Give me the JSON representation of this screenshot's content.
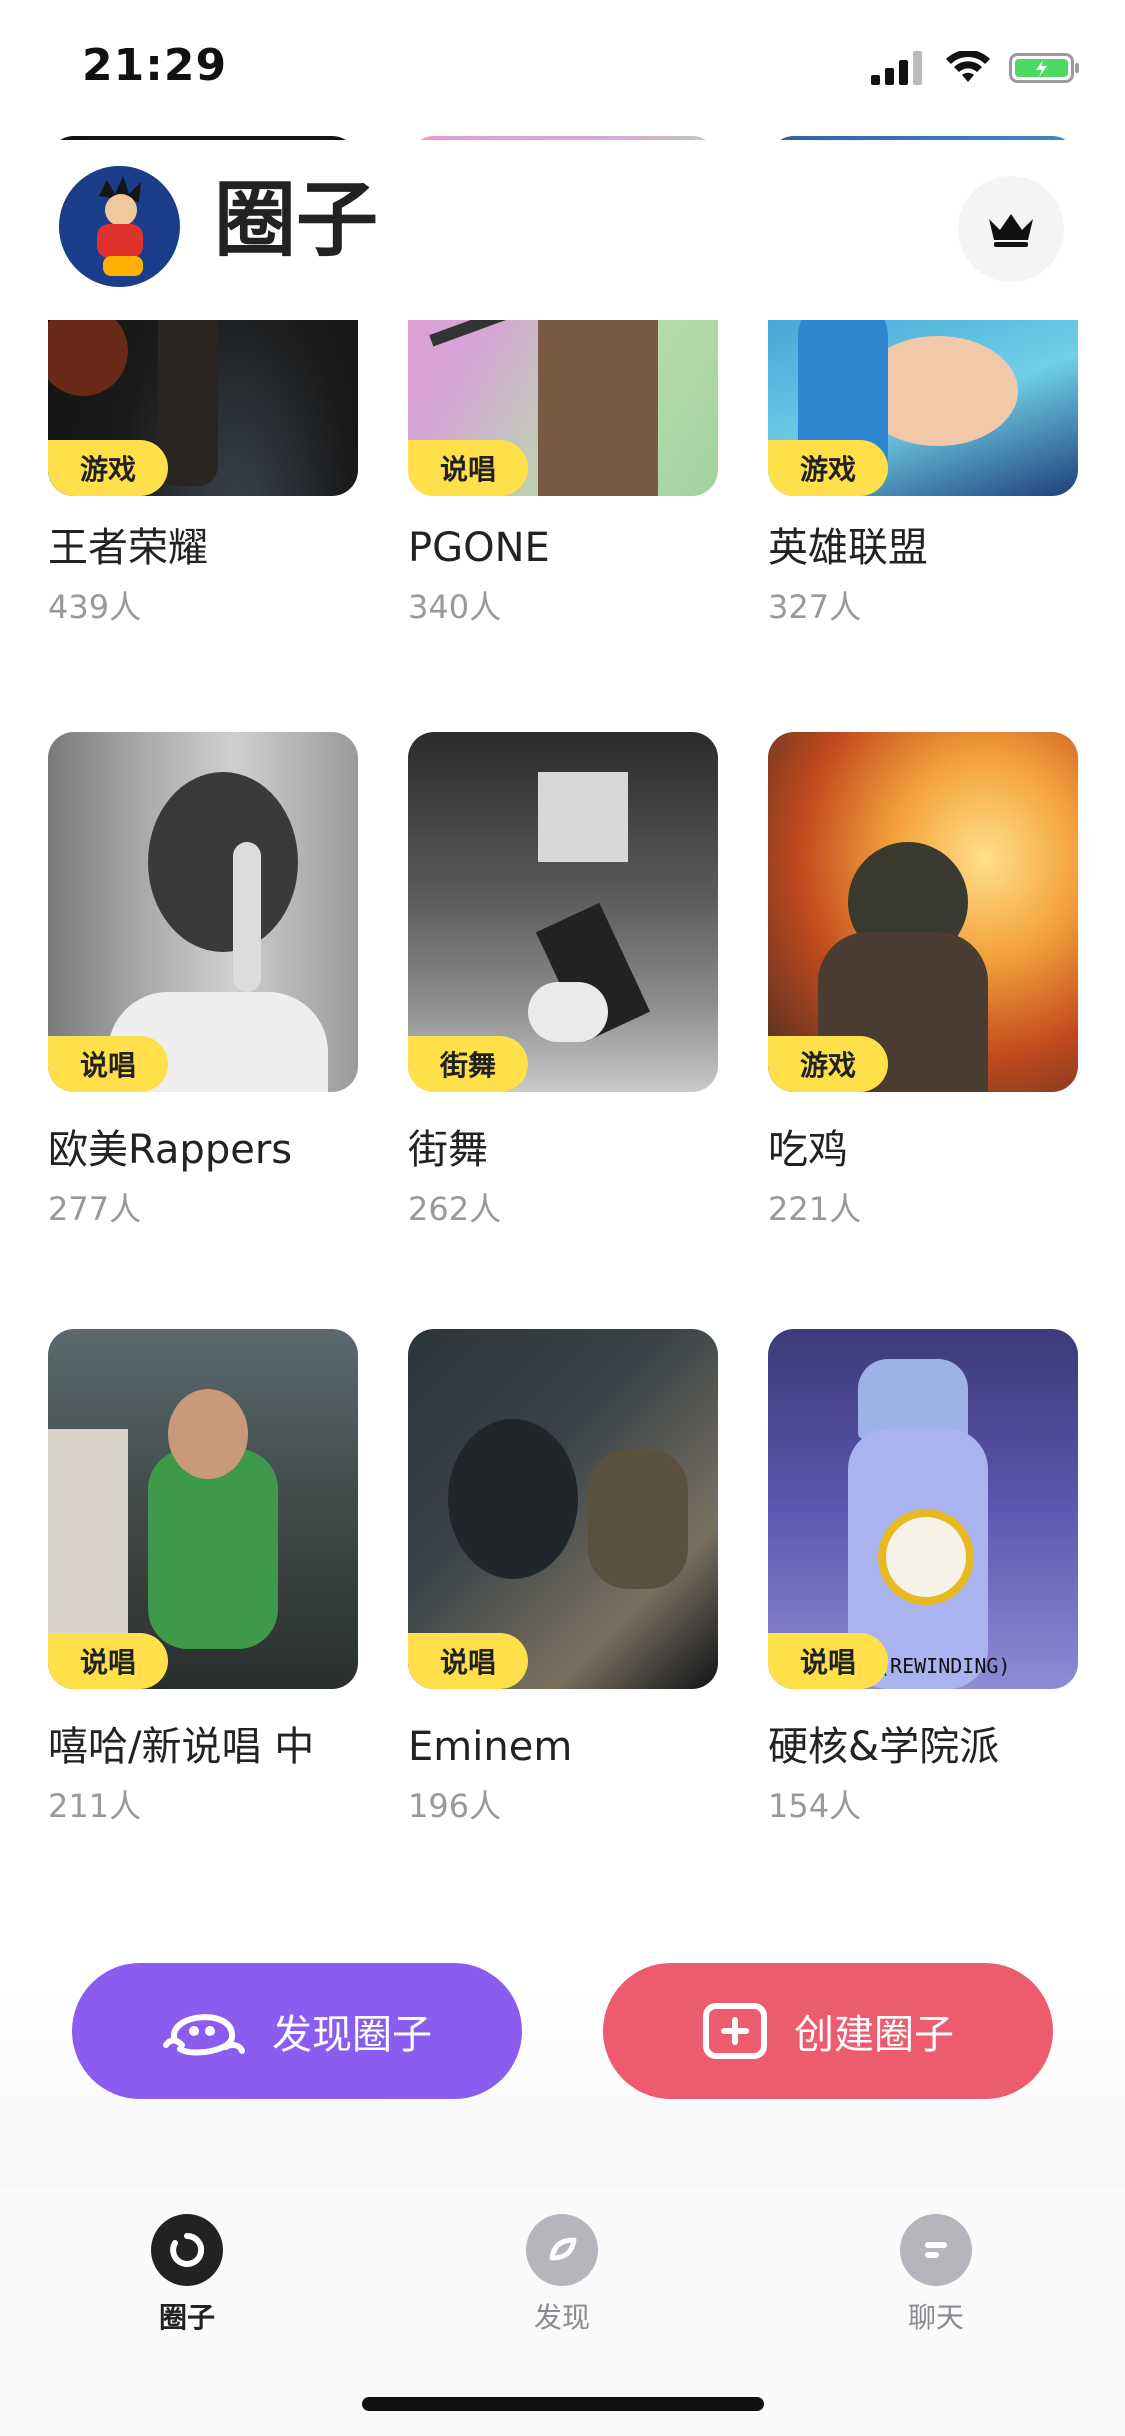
{
  "status": {
    "time": "21:29"
  },
  "header": {
    "title": "圈子"
  },
  "circles": [
    {
      "name": "王者荣耀",
      "count": "439人",
      "tag": "游戏"
    },
    {
      "name": "PGONE",
      "count": "340人",
      "tag": "说唱"
    },
    {
      "name": "英雄联盟",
      "count": "327人",
      "tag": "游戏"
    },
    {
      "name": "欧美Rappers",
      "count": "277人",
      "tag": "说唱"
    },
    {
      "name": "街舞",
      "count": "262人",
      "tag": "街舞"
    },
    {
      "name": "吃鸡",
      "count": "221人",
      "tag": "游戏"
    },
    {
      "name": "嘻哈/新说唱    中",
      "count": "211人",
      "tag": "说唱"
    },
    {
      "name": "Eminem",
      "count": "196人",
      "tag": "说唱"
    },
    {
      "name": "硬核&学院派",
      "count": "154人",
      "tag": "说唱"
    }
  ],
  "thumb_caption": "(REWINDING)",
  "actions": {
    "discover_label": "发现圈子",
    "create_label": "创建圈子"
  },
  "tabs": [
    {
      "label": "圈子",
      "active": true
    },
    {
      "label": "发现",
      "active": false
    },
    {
      "label": "聊天",
      "active": false
    }
  ],
  "colors": {
    "tag": "#ffe04a",
    "discover": "#8a5cf0",
    "create": "#ed5b6e",
    "active_tab": "#222222",
    "inactive_tab": "#b5b5bb"
  }
}
